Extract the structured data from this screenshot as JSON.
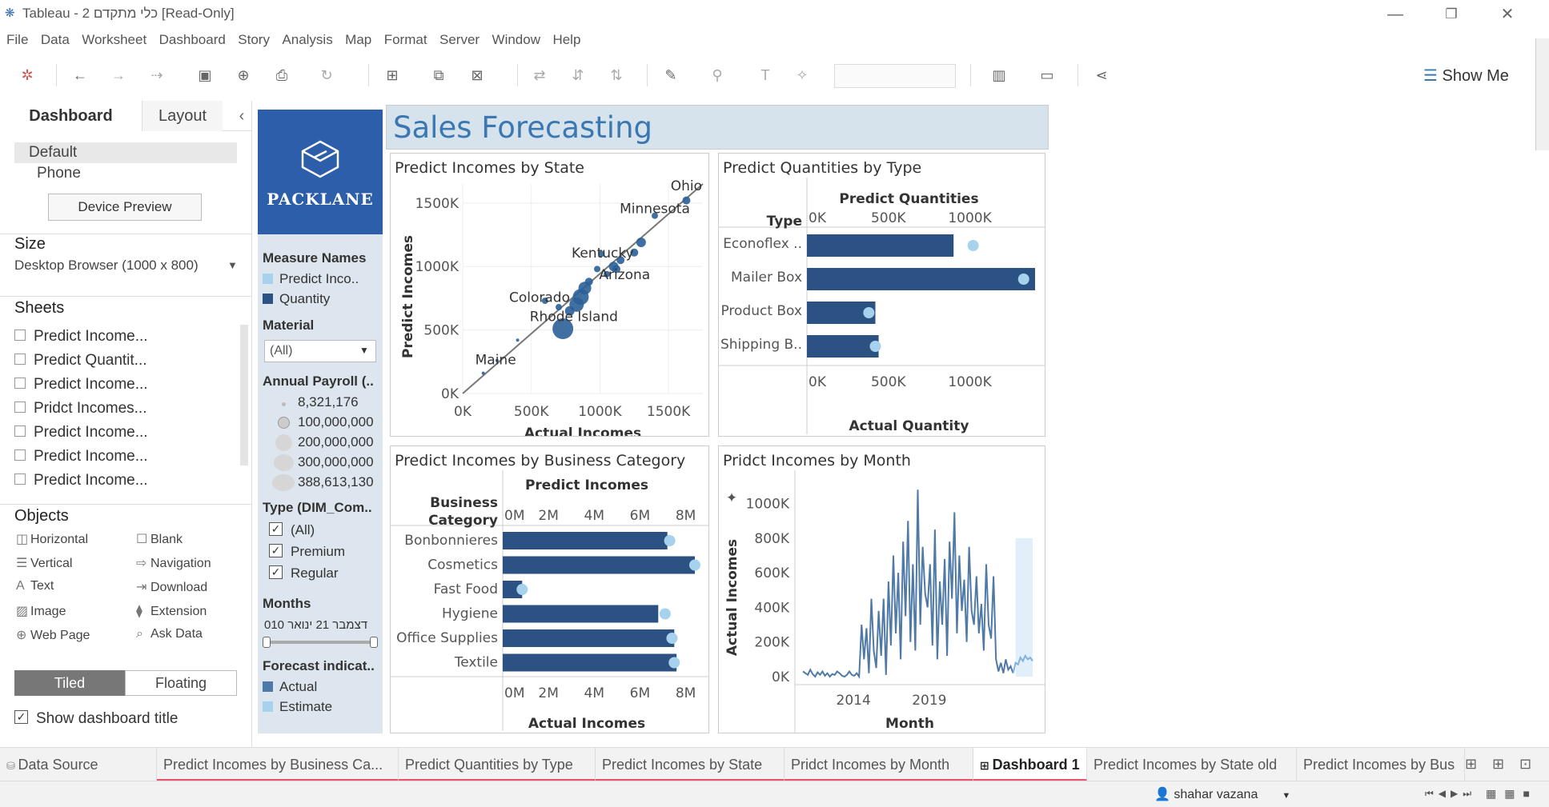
{
  "window": {
    "title": "Tableau - 2 כלי מתקדם [Read-Only]",
    "minimize": "—",
    "restore": "❐",
    "close": "✕"
  },
  "menu": [
    "File",
    "Data",
    "Worksheet",
    "Dashboard",
    "Story",
    "Analysis",
    "Map",
    "Format",
    "Server",
    "Window",
    "Help"
  ],
  "toolbar": {
    "show_me": "Show Me"
  },
  "left_panel": {
    "tab_dashboard": "Dashboard",
    "tab_layout": "Layout",
    "collapse": "‹",
    "device_default": "Default",
    "device_phone": "Phone",
    "device_preview": "Device Preview",
    "size_heading": "Size",
    "size_value": "Desktop Browser (1000 x 800)",
    "sheets_heading": "Sheets",
    "sheets": [
      "Predict Income...",
      "Predict Quantit...",
      "Predict Income...",
      "Pridct Incomes...",
      "Predict Income...",
      "Predict Income...",
      "Predict Income..."
    ],
    "objects_heading": "Objects",
    "objects_left": [
      "Horizontal",
      "Vertical",
      "Text",
      "Image",
      "Web Page"
    ],
    "objects_right": [
      "Blank",
      "Navigation",
      "Download",
      "Extension",
      "Ask Data"
    ],
    "tiled": "Tiled",
    "floating": "Floating",
    "show_title": "Show dashboard title"
  },
  "filters": {
    "logo_text": "PACKLANE",
    "measure_names": "Measure Names",
    "measure_items": [
      "Predict Inco..",
      "Quantity"
    ],
    "measure_colors": [
      "#a7d2ee",
      "#2b5283"
    ],
    "material": "Material",
    "material_value": "(All)",
    "payroll": "Annual Payroll (..",
    "payroll_values": [
      "8,321,176",
      "100,000,000",
      "200,000,000",
      "300,000,000",
      "388,613,130"
    ],
    "type": "Type (DIM_Com..",
    "type_items": [
      "(All)",
      "Premium",
      "Regular"
    ],
    "months": "Months",
    "months_range": "010 דצמבר 21 ינואר",
    "forecast": "Forecast indicat..",
    "forecast_items": [
      "Actual",
      "Estimate"
    ],
    "forecast_colors": [
      "#4f79a6",
      "#a7d2ee"
    ]
  },
  "dashboard": {
    "title": "Sales Forecasting"
  },
  "chart_data": [
    {
      "type": "scatter",
      "title": "Predict Incomes by State",
      "xlabel": "Actual Incomes",
      "ylabel": "Predict Incomes",
      "x_ticks": [
        "0K",
        "500K",
        "1000K",
        "1500K"
      ],
      "y_ticks": [
        "0K",
        "500K",
        "1000K",
        "1500K"
      ],
      "xlim": [
        0,
        1750000
      ],
      "ylim": [
        0,
        1650000
      ],
      "labels": [
        {
          "name": "Ohio",
          "x": 1630000,
          "y": 1600000
        },
        {
          "name": "Minnesota",
          "x": 1400000,
          "y": 1420000
        },
        {
          "name": "Kentucky",
          "x": 1020000,
          "y": 1070000
        },
        {
          "name": "Arizona",
          "x": 1180000,
          "y": 900000
        },
        {
          "name": "Colorado",
          "x": 560000,
          "y": 720000
        },
        {
          "name": "Rhode Island",
          "x": 810000,
          "y": 570000
        },
        {
          "name": "Maine",
          "x": 240000,
          "y": 230000
        }
      ],
      "points": [
        {
          "x": 1630000,
          "y": 1520000,
          "r": 5
        },
        {
          "x": 1400000,
          "y": 1400000,
          "r": 4
        },
        {
          "x": 1300000,
          "y": 1190000,
          "r": 6
        },
        {
          "x": 1250000,
          "y": 1110000,
          "r": 5
        },
        {
          "x": 1150000,
          "y": 1050000,
          "r": 5
        },
        {
          "x": 1100000,
          "y": 1000000,
          "r": 6
        },
        {
          "x": 1050000,
          "y": 940000,
          "r": 4
        },
        {
          "x": 1120000,
          "y": 980000,
          "r": 5
        },
        {
          "x": 980000,
          "y": 980000,
          "r": 4
        },
        {
          "x": 920000,
          "y": 880000,
          "r": 5
        },
        {
          "x": 890000,
          "y": 830000,
          "r": 8
        },
        {
          "x": 860000,
          "y": 760000,
          "r": 10
        },
        {
          "x": 830000,
          "y": 700000,
          "r": 9
        },
        {
          "x": 780000,
          "y": 650000,
          "r": 6
        },
        {
          "x": 700000,
          "y": 680000,
          "r": 4
        },
        {
          "x": 600000,
          "y": 730000,
          "r": 4
        },
        {
          "x": 730000,
          "y": 510000,
          "r": 13
        },
        {
          "x": 400000,
          "y": 420000,
          "r": 2
        },
        {
          "x": 250000,
          "y": 260000,
          "r": 2
        },
        {
          "x": 150000,
          "y": 160000,
          "r": 2
        },
        {
          "x": 1010000,
          "y": 1100000,
          "r": 4
        }
      ],
      "trend": [
        [
          0,
          0
        ],
        [
          1750000,
          1650000
        ]
      ]
    },
    {
      "type": "bar",
      "title": "Predict Quantities by Type",
      "column_header": "Predict Quantities",
      "row_header": "Type",
      "xlabel": "Actual Quantity",
      "x_ticks": [
        "0K",
        "500K",
        "1000K"
      ],
      "xlim": [
        0,
        1400000
      ],
      "categories": [
        "Econoflex ..",
        "Mailer Box",
        "Product Box",
        "Shipping B.."
      ],
      "values": [
        900000,
        1400000,
        420000,
        440000
      ],
      "predicted": [
        1020000,
        1330000,
        380000,
        420000
      ]
    },
    {
      "type": "bar",
      "title": "Predict Incomes by Business Category",
      "column_header": "Predict Incomes",
      "row_header_line1": "Business",
      "row_header_line2": "Category",
      "xlabel": "Actual Incomes",
      "x_ticks": [
        "0M",
        "2M",
        "4M",
        "6M",
        "8M"
      ],
      "xlim": [
        0,
        8400000
      ],
      "categories": [
        "Bonbonnieres",
        "Cosmetics",
        "Fast Food",
        "Hygiene",
        "Office Supplies",
        "Textile"
      ],
      "values": [
        7200000,
        8400000,
        850000,
        6800000,
        7500000,
        7600000
      ],
      "predicted": [
        7300000,
        8400000,
        850000,
        7100000,
        7400000,
        7500000
      ]
    },
    {
      "type": "line",
      "title": "Pridct Incomes by Month",
      "xlabel": "Month",
      "ylabel": "Actual Incomes",
      "x_ticks": [
        "2014",
        "2019"
      ],
      "y_ticks": [
        "0K",
        "200K",
        "400K",
        "600K",
        "800K",
        "1000K"
      ],
      "ylim": [
        0,
        1100000
      ],
      "series": [
        {
          "name": "Actual",
          "values": [
            30000,
            20000,
            10000,
            40000,
            15000,
            0,
            25000,
            10000,
            30000,
            5000,
            20000,
            0,
            15000,
            10000,
            30000,
            20000,
            5000,
            0,
            10000,
            30000,
            10000,
            5000,
            20000,
            0,
            300000,
            100000,
            280000,
            20000,
            450000,
            150000,
            50000,
            380000,
            120000,
            450000,
            10000,
            550000,
            180000,
            700000,
            250000,
            600000,
            100000,
            780000,
            350000,
            900000,
            200000,
            650000,
            150000,
            1080000,
            300000,
            750000,
            480000,
            400000,
            650000,
            180000,
            850000,
            100000,
            550000,
            300000,
            680000,
            120000,
            780000,
            450000,
            950000,
            250000,
            700000,
            380000,
            560000,
            200000,
            750000,
            380000,
            300000,
            580000,
            250000,
            420000,
            150000,
            650000,
            300000,
            220000,
            580000,
            100000,
            30000,
            80000,
            20000,
            100000,
            40000,
            60000,
            20000
          ]
        },
        {
          "name": "Estimate",
          "values": [
            80000,
            70000,
            110000,
            90000,
            120000,
            100000,
            110000,
            90000
          ]
        }
      ]
    }
  ],
  "bottom_tabs": {
    "data_source": "Data Source",
    "tabs": [
      "Predict Incomes by Business Ca...",
      "Predict Quantities by Type",
      "Predict Incomes by State",
      "Pridct Incomes by Month",
      "Dashboard 1",
      "Predict Incomes by State old",
      "Predict Incomes by Bus"
    ]
  },
  "status": {
    "user": "shahar vazana"
  }
}
